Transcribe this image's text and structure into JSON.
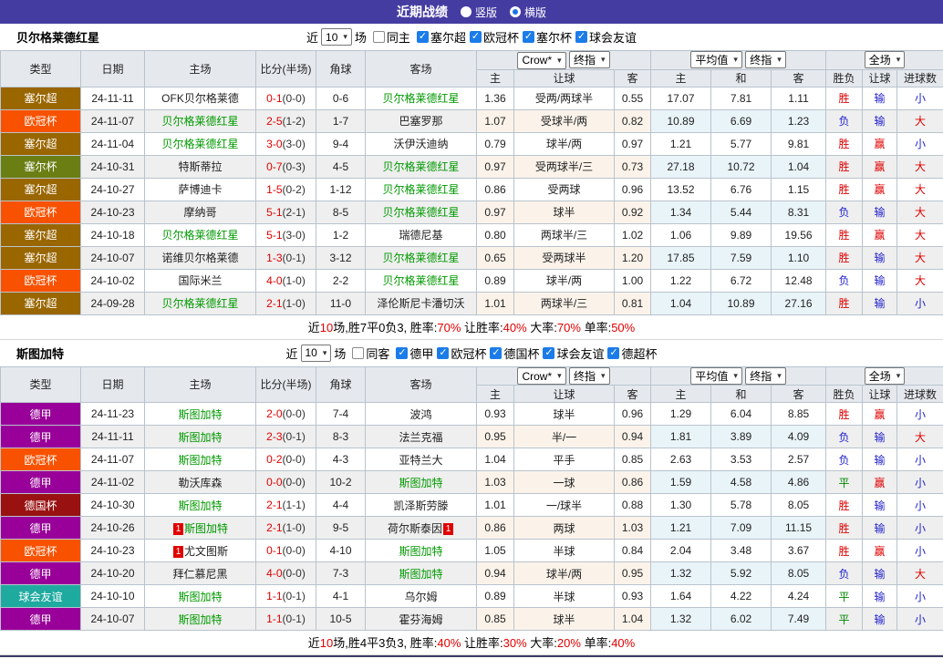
{
  "topbar": {
    "title": "近期战绩",
    "options": [
      {
        "label": "竖版",
        "selected": false
      },
      {
        "label": "横版",
        "selected": true
      }
    ]
  },
  "icons": {
    "dropdown_arrow": "▾",
    "checkbox_check": "✓",
    "radio_dot": "●"
  },
  "accent_colors": {
    "topbar": "#453CA2",
    "score_red": "#e00000",
    "team_green": "#009900",
    "loss_blue": "#2222cc"
  },
  "league_colors": {
    "塞尔超": "#996600",
    "欧冠杯": "#F85200",
    "塞尔杯": "#6B7E14",
    "德甲": "#990099",
    "德国杯": "#991111",
    "球会友谊": "#1FAAA0"
  },
  "table_headers": {
    "main": [
      "类型",
      "日期",
      "主场",
      "比分(半场)",
      "角球",
      "客场"
    ],
    "sub": [
      "主",
      "让球",
      "客",
      "主",
      "和",
      "客",
      "胜负",
      "让球",
      "进球数"
    ]
  },
  "sections": [
    {
      "team": "贝尔格莱德红星",
      "filter": {
        "near_label": "近",
        "count": "10",
        "games_label": "场",
        "same_label": "同主",
        "same_checked": false,
        "leagues": [
          "塞尔超",
          "欧冠杯",
          "塞尔杯",
          "球会友谊"
        ]
      },
      "selects": {
        "book": "Crow*",
        "book_stage": "终指",
        "avg": "平均值",
        "avg_stage": "终指",
        "scope": "全场"
      },
      "rows": [
        {
          "l": "塞尔超",
          "d": "24-11-11",
          "h": "OFK贝尔格莱德",
          "s": "0-1",
          "ht": "(0-0)",
          "c": "0-6",
          "a": "贝尔格莱德红星",
          "ag": true,
          "o1": "1.36",
          "hd": "受两/两球半",
          "o2": "0.55",
          "m1": "17.07",
          "m2": "7.81",
          "m3": "1.11",
          "r1": "胜",
          "r2": "输",
          "r3": "小"
        },
        {
          "l": "欧冠杯",
          "d": "24-11-07",
          "h": "贝尔格莱德红星",
          "hg": true,
          "s": "2-5",
          "ht": "(1-2)",
          "c": "1-7",
          "a": "巴塞罗那",
          "o1": "1.07",
          "hd": "受球半/两",
          "o2": "0.82",
          "m1": "10.89",
          "m2": "6.69",
          "m3": "1.23",
          "r1": "负",
          "r2": "输",
          "r3": "大"
        },
        {
          "l": "塞尔超",
          "d": "24-11-04",
          "h": "贝尔格莱德红星",
          "hg": true,
          "s": "3-0",
          "ht": "(3-0)",
          "c": "9-4",
          "a": "沃伊沃迪纳",
          "o1": "0.79",
          "hd": "球半/两",
          "o2": "0.97",
          "m1": "1.21",
          "m2": "5.77",
          "m3": "9.81",
          "r1": "胜",
          "r2": "赢",
          "r3": "小"
        },
        {
          "l": "塞尔杯",
          "d": "24-10-31",
          "h": "特斯蒂拉",
          "s": "0-7",
          "ht": "(0-3)",
          "c": "4-5",
          "a": "贝尔格莱德红星",
          "ag": true,
          "o1": "0.97",
          "hd": "受两球半/三",
          "o2": "0.73",
          "m1": "27.18",
          "m2": "10.72",
          "m3": "1.04",
          "r1": "胜",
          "r2": "赢",
          "r3": "大"
        },
        {
          "l": "塞尔超",
          "d": "24-10-27",
          "h": "萨博迪卡",
          "s": "1-5",
          "ht": "(0-2)",
          "c": "1-12",
          "a": "贝尔格莱德红星",
          "ag": true,
          "o1": "0.86",
          "hd": "受两球",
          "o2": "0.96",
          "m1": "13.52",
          "m2": "6.76",
          "m3": "1.15",
          "r1": "胜",
          "r2": "赢",
          "r3": "大"
        },
        {
          "l": "欧冠杯",
          "d": "24-10-23",
          "h": "摩纳哥",
          "s": "5-1",
          "ht": "(2-1)",
          "c": "8-5",
          "a": "贝尔格莱德红星",
          "ag": true,
          "o1": "0.97",
          "hd": "球半",
          "o2": "0.92",
          "m1": "1.34",
          "m2": "5.44",
          "m3": "8.31",
          "r1": "负",
          "r2": "输",
          "r3": "大"
        },
        {
          "l": "塞尔超",
          "d": "24-10-18",
          "h": "贝尔格莱德红星",
          "hg": true,
          "s": "5-1",
          "ht": "(3-0)",
          "c": "1-2",
          "a": "瑞德尼基",
          "o1": "0.80",
          "hd": "两球半/三",
          "o2": "1.02",
          "m1": "1.06",
          "m2": "9.89",
          "m3": "19.56",
          "r1": "胜",
          "r2": "赢",
          "r3": "大"
        },
        {
          "l": "塞尔超",
          "d": "24-10-07",
          "h": "诺维贝尔格莱德",
          "s": "1-3",
          "ht": "(0-1)",
          "c": "3-12",
          "a": "贝尔格莱德红星",
          "ag": true,
          "o1": "0.65",
          "hd": "受两球半",
          "o2": "1.20",
          "m1": "17.85",
          "m2": "7.59",
          "m3": "1.10",
          "r1": "胜",
          "r2": "输",
          "r3": "大"
        },
        {
          "l": "欧冠杯",
          "d": "24-10-02",
          "h": "国际米兰",
          "s": "4-0",
          "ht": "(1-0)",
          "c": "2-2",
          "a": "贝尔格莱德红星",
          "ag": true,
          "o1": "0.89",
          "hd": "球半/两",
          "o2": "1.00",
          "m1": "1.22",
          "m2": "6.72",
          "m3": "12.48",
          "r1": "负",
          "r2": "输",
          "r3": "大"
        },
        {
          "l": "塞尔超",
          "d": "24-09-28",
          "h": "贝尔格莱德红星",
          "hg": true,
          "s": "2-1",
          "ht": "(1-0)",
          "c": "11-0",
          "a": "泽伦斯尼卡潘切沃",
          "o1": "1.01",
          "hd": "两球半/三",
          "o2": "0.81",
          "m1": "1.04",
          "m2": "10.89",
          "m3": "27.16",
          "r1": "胜",
          "r2": "输",
          "r3": "小"
        }
      ],
      "summary": [
        {
          "t": "近"
        },
        {
          "t": "10",
          "r": 1
        },
        {
          "t": "场,胜7平0负3, 胜率:"
        },
        {
          "t": "70%",
          "r": 1
        },
        {
          "t": " 让胜率:"
        },
        {
          "t": "40%",
          "r": 1
        },
        {
          "t": " 大率:"
        },
        {
          "t": "70%",
          "r": 1
        },
        {
          "t": " 单率:"
        },
        {
          "t": "50%",
          "r": 1
        }
      ]
    },
    {
      "team": "斯图加特",
      "filter": {
        "near_label": "近",
        "count": "10",
        "games_label": "场",
        "same_label": "同客",
        "same_checked": false,
        "leagues": [
          "德甲",
          "欧冠杯",
          "德国杯",
          "球会友谊",
          "德超杯"
        ]
      },
      "selects": {
        "book": "Crow*",
        "book_stage": "终指",
        "avg": "平均值",
        "avg_stage": "终指",
        "scope": "全场"
      },
      "rows": [
        {
          "l": "德甲",
          "d": "24-11-23",
          "h": "斯图加特",
          "hg": true,
          "s": "2-0",
          "ht": "(0-0)",
          "c": "7-4",
          "a": "波鸿",
          "o1": "0.93",
          "hd": "球半",
          "o2": "0.96",
          "m1": "1.29",
          "m2": "6.04",
          "m3": "8.85",
          "r1": "胜",
          "r2": "赢",
          "r3": "小"
        },
        {
          "l": "德甲",
          "d": "24-11-11",
          "h": "斯图加特",
          "hg": true,
          "s": "2-3",
          "ht": "(0-1)",
          "c": "8-3",
          "a": "法兰克福",
          "o1": "0.95",
          "hd": "半/一",
          "o2": "0.94",
          "m1": "1.81",
          "m2": "3.89",
          "m3": "4.09",
          "r1": "负",
          "r2": "输",
          "r3": "大"
        },
        {
          "l": "欧冠杯",
          "d": "24-11-07",
          "h": "斯图加特",
          "hg": true,
          "s": "0-2",
          "ht": "(0-0)",
          "c": "4-3",
          "a": "亚特兰大",
          "o1": "1.04",
          "hd": "平手",
          "o2": "0.85",
          "m1": "2.63",
          "m2": "3.53",
          "m3": "2.57",
          "r1": "负",
          "r2": "输",
          "r3": "小"
        },
        {
          "l": "德甲",
          "d": "24-11-02",
          "h": "勒沃库森",
          "s": "0-0",
          "ht": "(0-0)",
          "c": "10-2",
          "a": "斯图加特",
          "ag": true,
          "o1": "1.03",
          "hd": "一球",
          "o2": "0.86",
          "m1": "1.59",
          "m2": "4.58",
          "m3": "4.86",
          "r1": "平",
          "r2": "赢",
          "r3": "小"
        },
        {
          "l": "德国杯",
          "d": "24-10-30",
          "h": "斯图加特",
          "hg": true,
          "s": "2-1",
          "ht": "(1-1)",
          "c": "4-4",
          "a": "凯泽斯劳滕",
          "o1": "1.01",
          "hd": "一/球半",
          "o2": "0.88",
          "m1": "1.30",
          "m2": "5.78",
          "m3": "8.05",
          "r1": "胜",
          "r2": "输",
          "r3": "小"
        },
        {
          "l": "德甲",
          "d": "24-10-26",
          "h": "斯图加特",
          "hg": true,
          "hc": true,
          "s": "2-1",
          "ht": "(1-0)",
          "c": "9-5",
          "a": "荷尔斯泰因",
          "ac": true,
          "o1": "0.86",
          "hd": "两球",
          "o2": "1.03",
          "m1": "1.21",
          "m2": "7.09",
          "m3": "11.15",
          "r1": "胜",
          "r2": "输",
          "r3": "小"
        },
        {
          "l": "欧冠杯",
          "d": "24-10-23",
          "h": "尤文图斯",
          "hc": true,
          "s": "0-1",
          "ht": "(0-0)",
          "c": "4-10",
          "a": "斯图加特",
          "ag": true,
          "o1": "1.05",
          "hd": "半球",
          "o2": "0.84",
          "m1": "2.04",
          "m2": "3.48",
          "m3": "3.67",
          "r1": "胜",
          "r2": "赢",
          "r3": "小"
        },
        {
          "l": "德甲",
          "d": "24-10-20",
          "h": "拜仁慕尼黑",
          "s": "4-0",
          "ht": "(0-0)",
          "c": "7-3",
          "a": "斯图加特",
          "ag": true,
          "o1": "0.94",
          "hd": "球半/两",
          "o2": "0.95",
          "m1": "1.32",
          "m2": "5.92",
          "m3": "8.05",
          "r1": "负",
          "r2": "输",
          "r3": "大"
        },
        {
          "l": "球会友谊",
          "d": "24-10-10",
          "h": "斯图加特",
          "hg": true,
          "s": "1-1",
          "ht": "(0-1)",
          "c": "4-1",
          "a": "乌尔姆",
          "o1": "0.89",
          "hd": "半球",
          "o2": "0.93",
          "m1": "1.64",
          "m2": "4.22",
          "m3": "4.24",
          "r1": "平",
          "r2": "输",
          "r3": "小"
        },
        {
          "l": "德甲",
          "d": "24-10-07",
          "h": "斯图加特",
          "hg": true,
          "s": "1-1",
          "ht": "(0-1)",
          "c": "10-5",
          "a": "霍芬海姆",
          "o1": "0.85",
          "hd": "球半",
          "o2": "1.04",
          "m1": "1.32",
          "m2": "6.02",
          "m3": "7.49",
          "r1": "平",
          "r2": "输",
          "r3": "小"
        }
      ],
      "summary": [
        {
          "t": "近"
        },
        {
          "t": "10",
          "r": 1
        },
        {
          "t": "场,胜4平3负3, 胜率:"
        },
        {
          "t": "40%",
          "r": 1
        },
        {
          "t": " 让胜率:"
        },
        {
          "t": "30%",
          "r": 1
        },
        {
          "t": " 大率:"
        },
        {
          "t": "20%",
          "r": 1
        },
        {
          "t": " 单率:"
        },
        {
          "t": "40%",
          "r": 1
        }
      ]
    }
  ]
}
